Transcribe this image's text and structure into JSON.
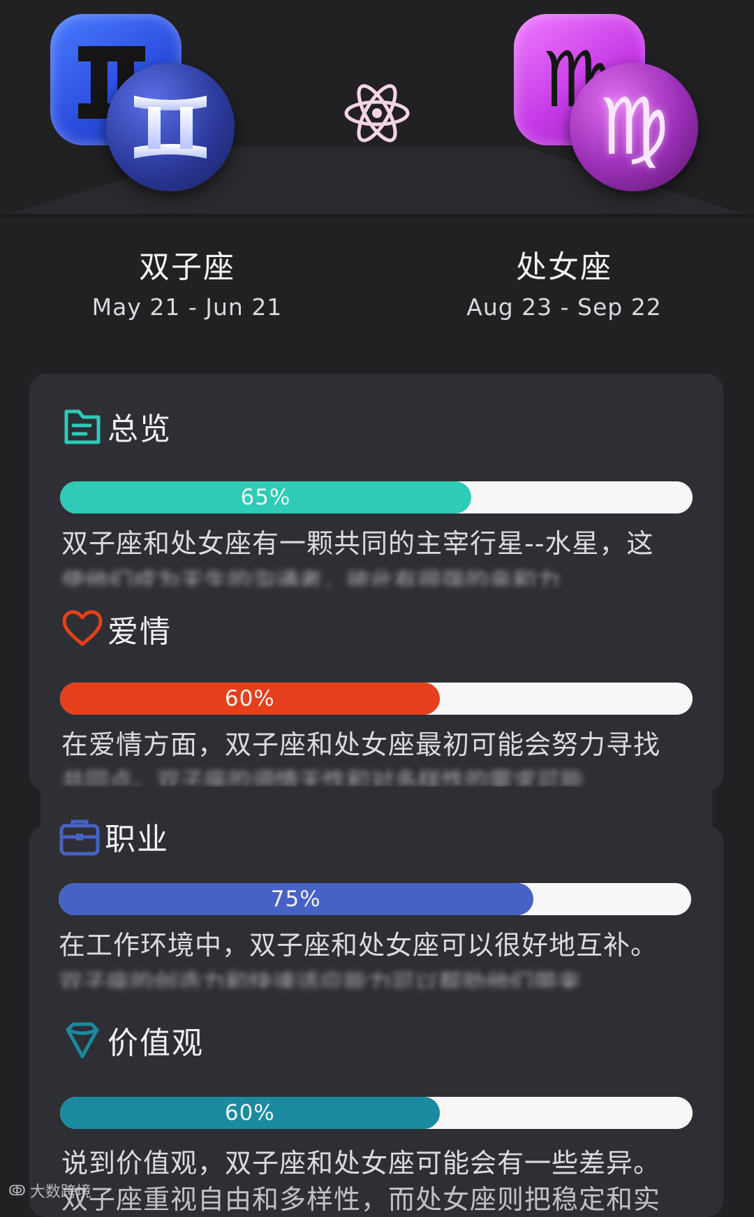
{
  "left_sign": {
    "name": "双子座",
    "date": "May 21 - Jun 21",
    "glyph": "Ⅱ",
    "icon": "gemini-icon",
    "color": "#2c4fe0"
  },
  "right_sign": {
    "name": "处女座",
    "date": "Aug 23 - Sep 22",
    "glyph": "♍",
    "icon": "virgo-icon",
    "color": "#c63ae6"
  },
  "center_icon": "atom-icon",
  "sections": [
    {
      "title": "总览",
      "icon": "document-icon",
      "percent": 65,
      "percent_label": "65%",
      "color": "#2ecbb6",
      "text": "双子座和处女座有一颗共同的主宰行星--水星，这",
      "blurred": "使他们成为天生的沟通者，彼此有很强的亲和力"
    },
    {
      "title": "爱情",
      "icon": "heart-icon",
      "percent": 60,
      "percent_label": "60%",
      "color": "#e5401b",
      "text": "在爱情方面，双子座和处女座最初可能会努力寻找",
      "blurred": "共同点。双子座的调情天性和对多样性的需求可能"
    },
    {
      "title": "职业",
      "icon": "briefcase-icon",
      "percent": 75,
      "percent_label": "75%",
      "color": "#4662c4",
      "text": "在工作环境中，双子座和处女座可以很好地互补。",
      "blurred": "双子座的创造力和快速适应能力可以帮助他们带来"
    },
    {
      "title": "价值观",
      "icon": "diamond-icon",
      "percent": 60,
      "percent_label": "60%",
      "color": "#1a8aa0",
      "text": "说到价值观，双子座和处女座可能会有一些差异。",
      "blurred": "双子座重视自由和多样性，而处女座则把稳定和实"
    }
  ],
  "watermark": "大数跨境"
}
